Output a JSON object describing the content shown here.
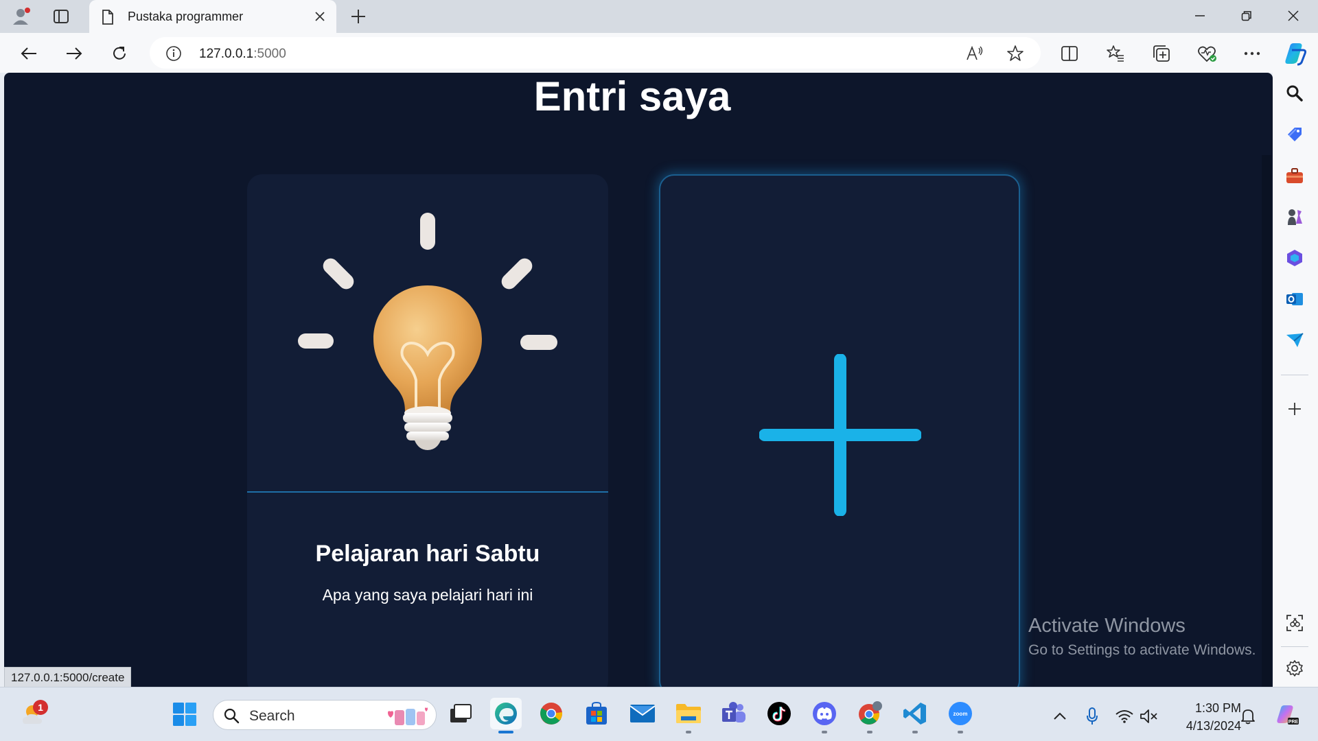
{
  "browser": {
    "tab_title": "Pustaka programmer",
    "url_host": "127.0.0.1",
    "url_port": ":5000",
    "status_link": "127.0.0.1:5000/create"
  },
  "page": {
    "title": "Entri saya",
    "entry": {
      "title": "Pelajaran hari Sabtu",
      "description": "Apa yang saya pelajari hari ini"
    },
    "accent_color": "#1ab2e8",
    "background_color": "#0d162b"
  },
  "watermark": {
    "line1": "Activate Windows",
    "line2": "Go to Settings to activate Windows."
  },
  "taskbar": {
    "weather_badge": "1",
    "search_placeholder": "Search",
    "time": "1:30 PM",
    "date": "4/13/2024"
  }
}
